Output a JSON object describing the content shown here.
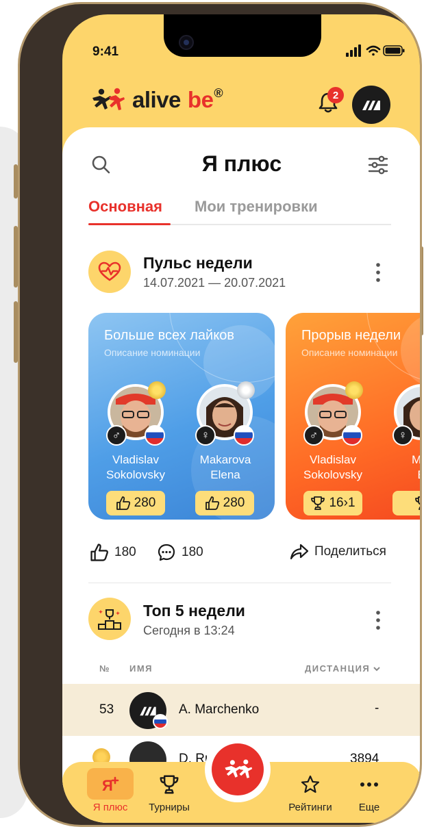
{
  "status_bar": {
    "time": "9:41"
  },
  "header": {
    "brand_word1": "alive",
    "brand_word2": "be",
    "brand_reg": "®",
    "notifications_count": "2"
  },
  "page": {
    "title": "Я плюс"
  },
  "tabs": [
    {
      "label": "Основная",
      "active": true
    },
    {
      "label": "Мои тренировки",
      "active": false
    }
  ],
  "pulse": {
    "title": "Пульс недели",
    "date_range": "14.07.2021 — 20.07.2021",
    "cards": [
      {
        "title": "Больше всех лайков",
        "description": "Описание номинации",
        "people": [
          {
            "first": "Vladislav",
            "last": "Sokolovsky",
            "value": "280",
            "medal": "gold",
            "sex": "♂"
          },
          {
            "first": "Makarova",
            "last": "Elena",
            "value": "280",
            "medal": "silver",
            "sex": "♀"
          }
        ]
      },
      {
        "title": "Прорыв недели",
        "description": "Описание номинации",
        "people": [
          {
            "first": "Vladislav",
            "last": "Sokolovsky",
            "value": "16›1",
            "medal": "gold",
            "sex": "♂"
          },
          {
            "first": "Mak",
            "last": "El",
            "value": "",
            "medal": "silver",
            "sex": "♀"
          }
        ]
      }
    ],
    "likes": "180",
    "comments": "180",
    "share_label": "Поделиться"
  },
  "top5": {
    "title": "Топ 5 недели",
    "subtitle": "Сегодня в  13:24",
    "columns": {
      "num": "№",
      "name": "ИМЯ",
      "distance": "ДИСТАНЦИЯ"
    },
    "rows": [
      {
        "rank": "53",
        "name": "A. Marchenko",
        "value": "-"
      },
      {
        "rank": "",
        "name": "D. Ru",
        "value": "3894"
      }
    ]
  },
  "nav": [
    {
      "label": "Я плюс",
      "icon": "person-plus-icon",
      "active": true
    },
    {
      "label": "Турниры",
      "icon": "trophy-icon",
      "active": false
    },
    {
      "label": "Рейтинги",
      "icon": "star-icon",
      "active": false
    },
    {
      "label": "Еще",
      "icon": "more-icon",
      "active": false
    }
  ],
  "colors": {
    "accent": "#e8312b",
    "brand_yellow": "#fdd56b",
    "blue_card": "#4f9ee7",
    "orange_card": "#ff6a25"
  }
}
